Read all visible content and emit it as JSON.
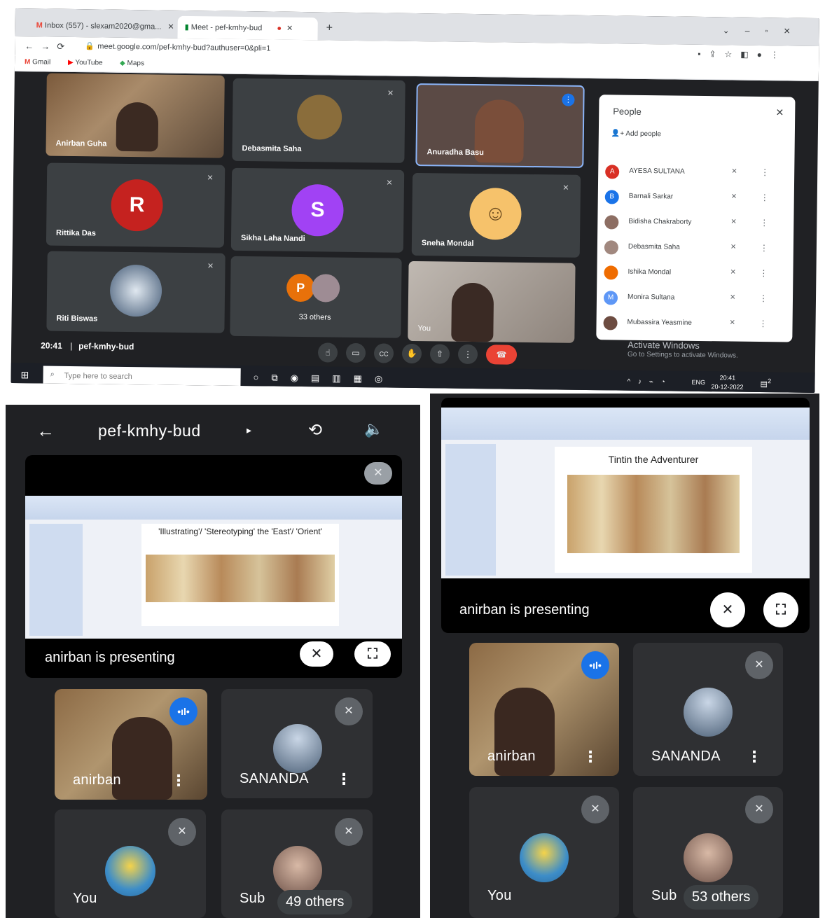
{
  "desktop": {
    "tabs": [
      {
        "label": "Inbox (557) - slexam2020@gma...",
        "icon": "gmail-icon"
      },
      {
        "label": "Meet - pef-kmhy-bud",
        "icon": "meet-icon"
      }
    ],
    "url": "meet.google.com/pef-kmhy-bud?authuser=0&pli=1",
    "bookmarks": [
      "Gmail",
      "YouTube",
      "Maps"
    ],
    "tiles": [
      {
        "name": "Anirban Guha"
      },
      {
        "name": "Debasmita Saha"
      },
      {
        "name": "Anuradha Basu"
      },
      {
        "name": "Rittika Das",
        "initial": "R",
        "color": "#c5221f"
      },
      {
        "name": "Sikha Laha Nandi",
        "initial": "S",
        "color": "#a142f4"
      },
      {
        "name": "Sneha Mondal"
      },
      {
        "name": "Riti Biswas"
      },
      {
        "name": "33 others",
        "initial": "P",
        "color": "#e8710a"
      },
      {
        "name": "You"
      }
    ],
    "meeting_time": "20:41",
    "meeting_code": "pef-kmhy-bud",
    "people_panel": {
      "title": "People",
      "add_label": "Add people",
      "people": [
        {
          "name": "AYESA SULTANA",
          "initial": "A",
          "color": "#d93025"
        },
        {
          "name": "Barnali Sarkar",
          "initial": "B",
          "color": "#1a73e8"
        },
        {
          "name": "Bidisha Chakraborty",
          "initial": "",
          "color": "#8d6e63"
        },
        {
          "name": "Debasmita Saha",
          "initial": "",
          "color": "#a1887f"
        },
        {
          "name": "Ishika Mondal",
          "initial": "",
          "color": "#ef6c00"
        },
        {
          "name": "Monira Sultana",
          "initial": "M",
          "color": "#5e97f6"
        },
        {
          "name": "Mubassira Yeasmine",
          "initial": "",
          "color": "#6d4c41"
        }
      ]
    },
    "activate": {
      "title": "Activate Windows",
      "subtitle": "Go to Settings to activate Windows."
    },
    "taskbar": {
      "search_placeholder": "Type here to search",
      "lang": "ENG",
      "time": "20:41",
      "date": "20-12-2022",
      "notif_count": "2"
    }
  },
  "phone_left": {
    "meeting_code": "pef-kmhy-bud",
    "slide_title": "'Illustrating'/ 'Stereotyping' the 'East'/ 'Orient'",
    "presenting_label": "anirban is presenting",
    "tiles": [
      {
        "name": "anirban"
      },
      {
        "name": "SANANDA"
      },
      {
        "name": "You"
      },
      {
        "name": "Sub"
      }
    ],
    "others_label": "49 others"
  },
  "phone_right": {
    "slide_title": "Tintin the Adventurer",
    "presenting_label": "anirban is presenting",
    "tiles": [
      {
        "name": "anirban"
      },
      {
        "name": "SANANDA"
      },
      {
        "name": "You"
      },
      {
        "name": "Sub"
      }
    ],
    "others_label": "53 others"
  },
  "colors": {
    "meet_bg": "#202124",
    "tile_bg": "#3c4043",
    "speaking": "#1a73e8",
    "end_call": "#ea4335"
  }
}
